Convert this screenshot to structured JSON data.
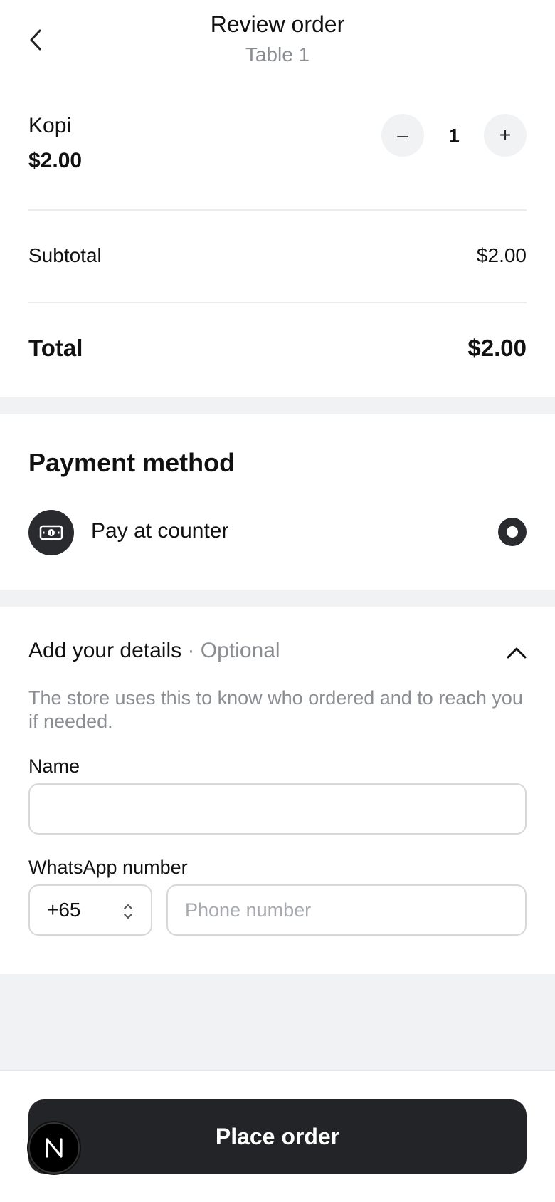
{
  "header": {
    "title": "Review order",
    "subtitle": "Table 1"
  },
  "cart": {
    "items": [
      {
        "name": "Kopi",
        "price": "$2.00",
        "quantity": "1"
      }
    ],
    "minus_label": "–",
    "plus_label": "+"
  },
  "summary": {
    "subtotal_label": "Subtotal",
    "subtotal_value": "$2.00",
    "total_label": "Total",
    "total_value": "$2.00"
  },
  "payment": {
    "title": "Payment method",
    "options": [
      {
        "label": "Pay at counter",
        "icon": "cash-icon",
        "selected": true
      }
    ]
  },
  "details": {
    "title": "Add your details",
    "optional": "· Optional",
    "helper": "The store uses this to know who ordered and to reach you if needed.",
    "name_label": "Name",
    "name_value": "",
    "whatsapp_label": "WhatsApp number",
    "country_code": "+65",
    "phone_placeholder": "Phone number"
  },
  "footer": {
    "place_order_label": "Place order",
    "badge_letter": "N"
  },
  "colors": {
    "primary": "#232427",
    "muted_text": "#8a8d92",
    "page_bg": "#f1f2f4"
  }
}
